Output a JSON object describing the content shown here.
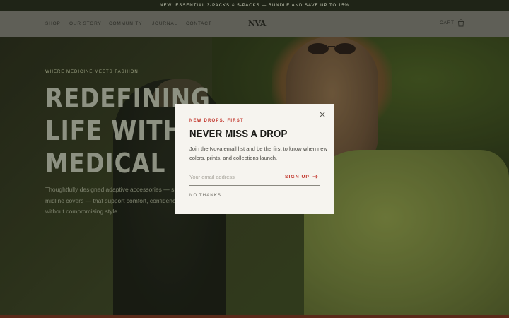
{
  "promo_bar": {
    "text": "NEW: ESSENTIAL 3-PACKS & 5-PACKS — BUNDLE AND SAVE UP TO 15%"
  },
  "header": {
    "nav": [
      "SHOP",
      "OUR STORY",
      "COMMUNITY",
      "JOURNAL",
      "CONTACT"
    ],
    "logo": "NVA",
    "cart_label": "CART"
  },
  "hero": {
    "eyebrow": "WHERE MEDICINE MEETS FASHION",
    "headline": "REDEFINING\nLIFE WITH\nMEDICAL D",
    "body": "Thoughtfully designed adaptive accessories — specializing in PICC line and midline covers — that support comfort, confidence, and personal identity without compromising style."
  },
  "modal": {
    "eyebrow": "NEW DROPS, FIRST",
    "title": "NEVER MISS A DROP",
    "text": "Join the Nova email list and be the first to know when new colors, prints, and collections launch.",
    "email_placeholder": "Your email address",
    "email_value": "",
    "signup_label": "SIGN UP",
    "dismiss_label": "NO THANKS",
    "icons": [
      "close-icon",
      "arrow-right-icon",
      "bag-icon"
    ]
  },
  "colors": {
    "accent": "#c2362c",
    "modal_bg": "#f6f4ef",
    "promo_bg": "#1f2417"
  }
}
